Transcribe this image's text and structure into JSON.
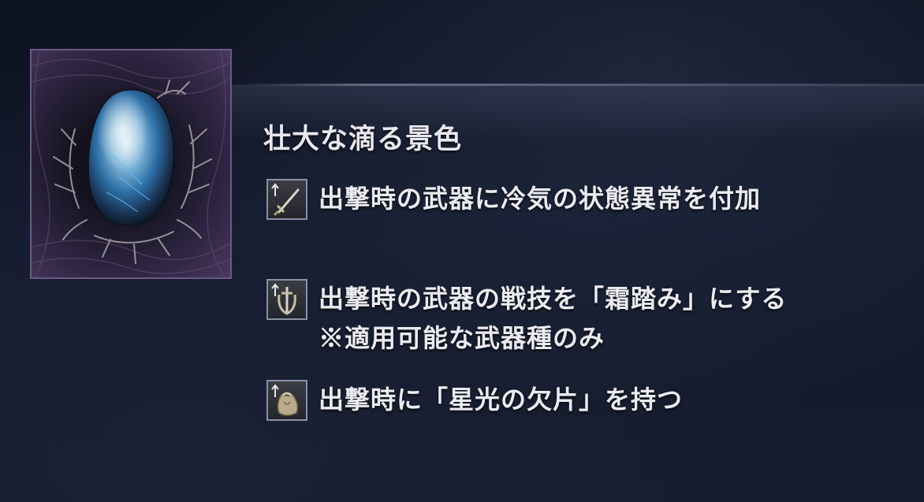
{
  "relic": {
    "name": "壮大な滴る景色",
    "image_icon": "blue-gemstone-in-branches-icon"
  },
  "effects": [
    {
      "icon": "sword-with-up-arrow-icon",
      "lines": [
        "出撃時の武器に冷気の状態異常を付加"
      ]
    },
    {
      "icon": "crossed-sword-shield-up-arrow-icon",
      "lines": [
        "出撃時の武器の戦技を「霜踏み」にする",
        "※適用可能な武器種のみ"
      ]
    },
    {
      "icon": "pouch-with-up-arrow-icon",
      "lines": [
        "出撃時に「星光の欠片」を持つ"
      ]
    }
  ],
  "colors": {
    "frame_border": "#6b5a86",
    "icon_border": "#8a8fa6",
    "text": "#ecebf1",
    "background": "#121a2c"
  }
}
